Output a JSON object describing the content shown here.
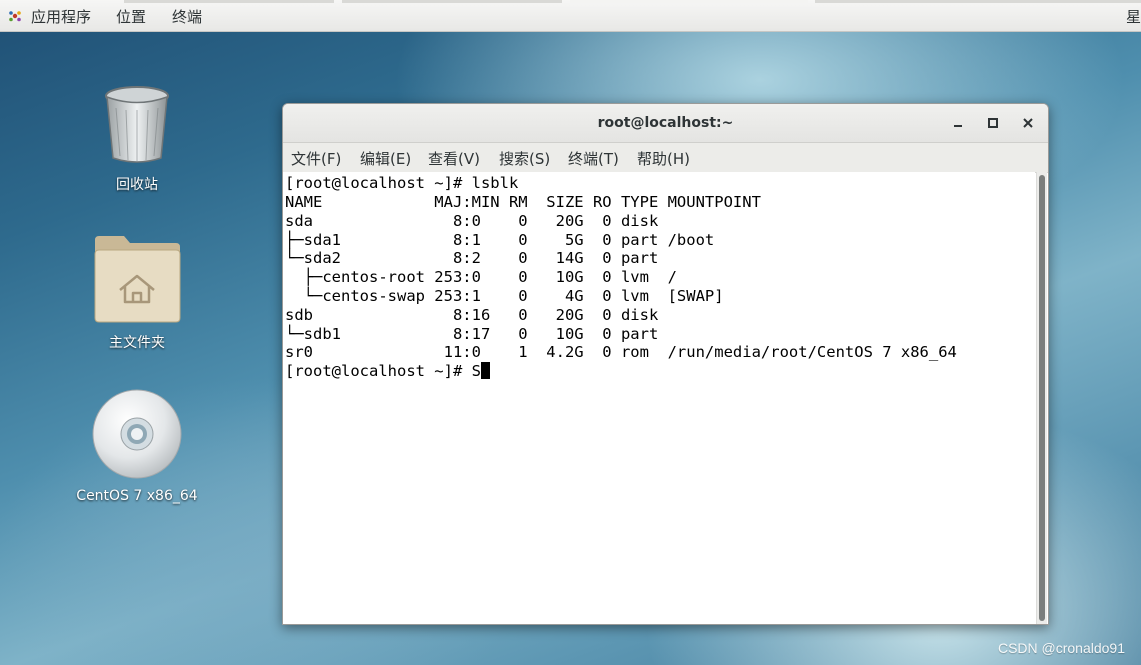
{
  "topbar": {
    "applications": "应用程序",
    "places": "位置",
    "terminal": "终端",
    "clock_partial": "星"
  },
  "desktop": {
    "icons": [
      {
        "label": "回收站",
        "icon": "trash-icon"
      },
      {
        "label": "主文件夹",
        "icon": "home-folder-icon"
      },
      {
        "label": "CentOS 7 x86_64",
        "icon": "disc-icon"
      }
    ]
  },
  "window": {
    "title": "root@localhost:~",
    "menu": [
      "文件(F)",
      "编辑(E)",
      "查看(V)",
      "搜索(S)",
      "终端(T)",
      "帮助(H)"
    ]
  },
  "terminal": {
    "lines": [
      "[root@localhost ~]# lsblk",
      "NAME            MAJ:MIN RM  SIZE RO TYPE MOUNTPOINT",
      "sda               8:0    0   20G  0 disk",
      "├─sda1            8:1    0    5G  0 part /boot",
      "└─sda2            8:2    0   14G  0 part",
      "  ├─centos-root 253:0    0   10G  0 lvm  /",
      "  └─centos-swap 253:1    0    4G  0 lvm  [SWAP]",
      "sdb               8:16   0   20G  0 disk",
      "└─sdb1            8:17   0   10G  0 part",
      "sr0              11:0    1  4.2G  0 rom  /run/media/root/CentOS 7 x86_64"
    ],
    "prompt_line": "[root@localhost ~]# S"
  },
  "watermark": "CSDN @cronaldo91"
}
